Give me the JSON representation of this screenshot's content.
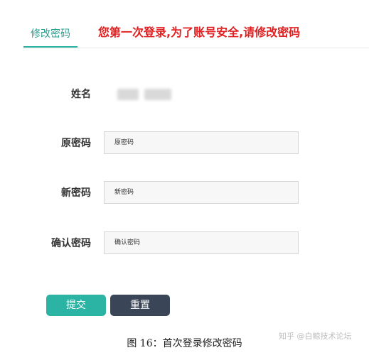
{
  "tabs": {
    "active_label": "修改密码"
  },
  "notice": "您第一次登录,为了账号安全,请修改密码",
  "form": {
    "name_label": "姓名",
    "old_password": {
      "label": "原密码",
      "placeholder": "原密码"
    },
    "new_password": {
      "label": "新密码",
      "placeholder": "新密码"
    },
    "confirm_password": {
      "label": "确认密码",
      "placeholder": "确认密码"
    }
  },
  "buttons": {
    "submit_label": "提交",
    "reset_label": "重置"
  },
  "caption": "图 16：首次登录修改密码",
  "watermark": "知乎 @白鲸技术论坛",
  "colors": {
    "accent": "#2bb3a3",
    "notice": "#e02020",
    "reset_button": "#3a4557"
  }
}
